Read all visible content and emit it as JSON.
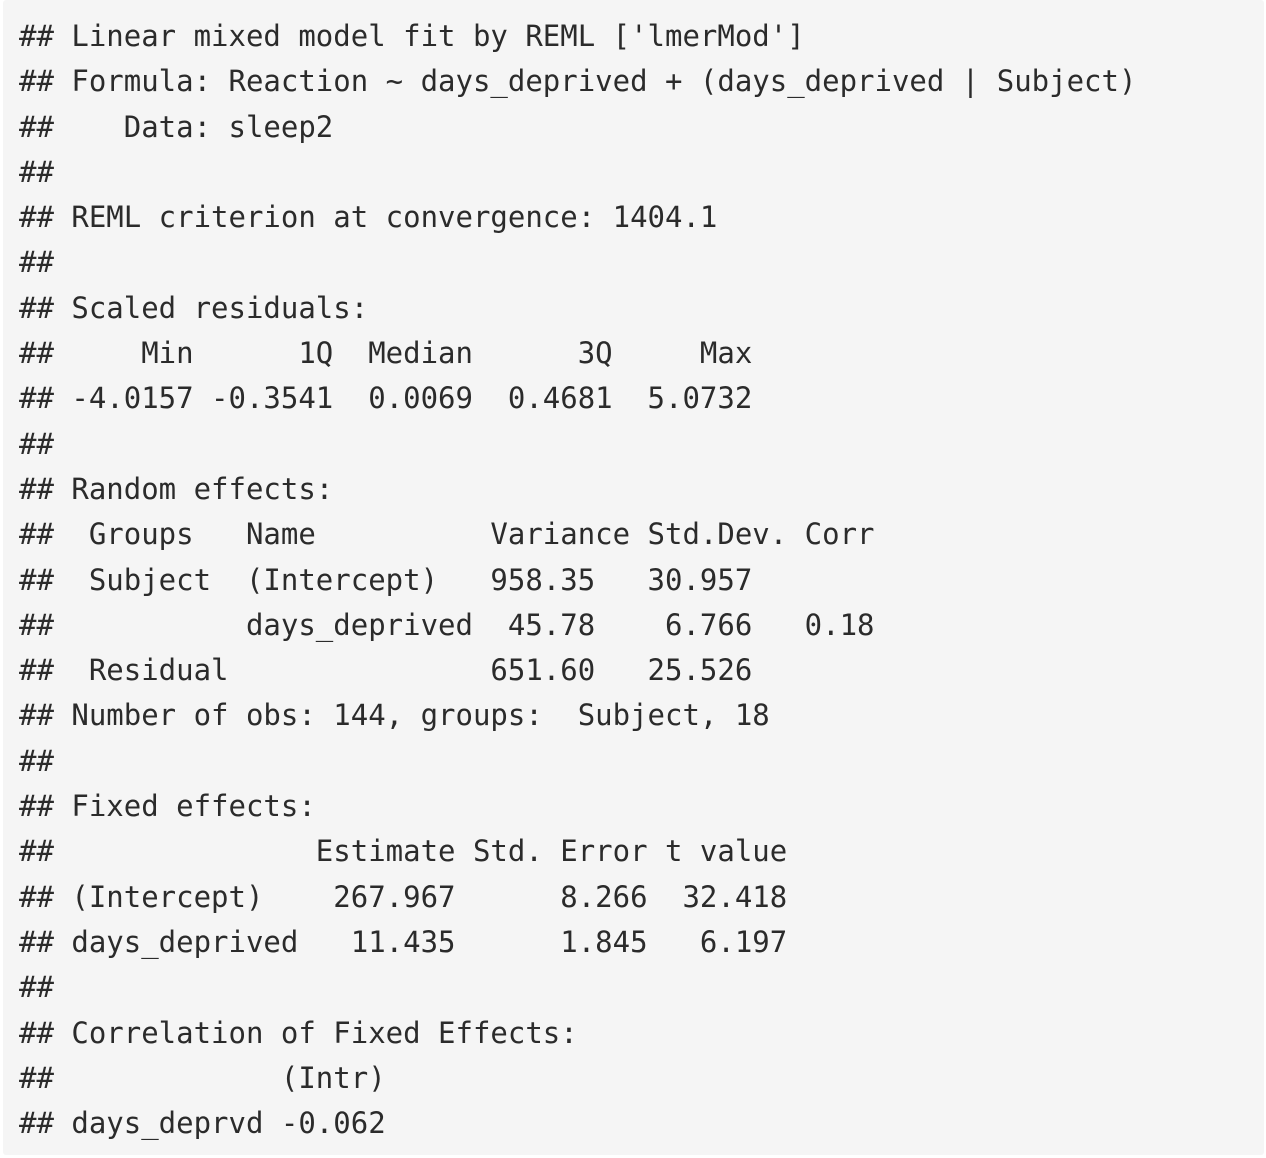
{
  "output": {
    "lines": [
      "## Linear mixed model fit by REML ['lmerMod']",
      "## Formula: Reaction ~ days_deprived + (days_deprived | Subject)",
      "##    Data: sleep2",
      "##",
      "## REML criterion at convergence: 1404.1",
      "##",
      "## Scaled residuals: ",
      "##     Min      1Q  Median      3Q     Max ",
      "## -4.0157 -0.3541  0.0069  0.4681  5.0732 ",
      "##",
      "## Random effects:",
      "##  Groups   Name          Variance Std.Dev. Corr",
      "##  Subject  (Intercept)   958.35   30.957       ",
      "##           days_deprived  45.78    6.766   0.18",
      "##  Residual               651.60   25.526       ",
      "## Number of obs: 144, groups:  Subject, 18",
      "##",
      "## Fixed effects:",
      "##               Estimate Std. Error t value",
      "## (Intercept)    267.967      8.266  32.418",
      "## days_deprived   11.435      1.845   6.197",
      "##",
      "## Correlation of Fixed Effects:",
      "##             (Intr)",
      "## days_deprvd -0.062"
    ]
  }
}
